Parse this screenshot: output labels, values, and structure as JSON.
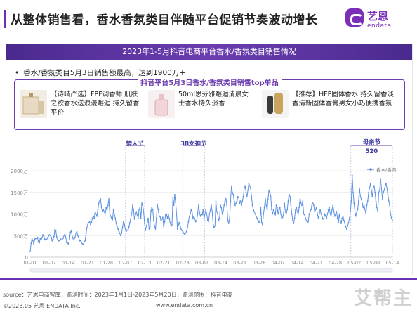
{
  "page": {
    "title": "从整体销售看，香水香氛类目伴随平台促销节奏波动增长",
    "logo_cn": "艺恩",
    "logo_en": "endata",
    "accent": "#6b2fb3"
  },
  "card": {
    "banner": "2023年1-5月抖音电商平台香水/香氛类目销售情况",
    "bullet": "香水/香氛类目5月3日销售额最高，达到1900万+",
    "products_title": "抖音平台5月3日香水/香氛类目销售top单品",
    "products": [
      {
        "text": "【诗晴严选】FPF调香师 肌肤之欲香水送浪漫邂逅 持久留香平价",
        "icon": "perfume-box-thumb"
      },
      {
        "text": "50ml思芬雅邂逅清晨女士香水持久淡香",
        "icon": "perfume-bottle-thumb"
      },
      {
        "text": "【推荐】HFP固体香水 持久留香淡香清新固体香膏男女小巧便携香氛",
        "icon": "solid-perfume-thumb"
      }
    ]
  },
  "chart_data": {
    "type": "line",
    "series": [
      {
        "name": "香水/香商",
        "color": "#5b8fe0"
      }
    ],
    "ylim": [
      0,
      2000
    ],
    "yticks": [
      "0",
      "500万",
      "1000万",
      "1500万",
      "2000万"
    ],
    "ytick_values": [
      0,
      500,
      1000,
      1500,
      2000
    ],
    "xticks": [
      "01-01",
      "01-07",
      "01-14",
      "01-21",
      "01-28",
      "02-07",
      "02-13",
      "02-21",
      "02-28",
      "03-07",
      "03-14",
      "03-21",
      "03-28",
      "04-07",
      "04-14",
      "04-21",
      "04-28",
      "05-02",
      "05-08",
      "05-14"
    ],
    "annotations": [
      {
        "label": "情人节",
        "from": "02-07",
        "to": "02-14"
      },
      {
        "label": "38女神节",
        "from": "02-28",
        "to": "03-08"
      },
      {
        "label": "母亲节",
        "sublabel": "520",
        "from": "05-01",
        "to": "05-20"
      }
    ],
    "values": [
      130,
      320,
      420,
      380,
      300,
      420,
      430,
      440,
      460,
      350,
      330,
      430,
      400,
      450,
      520,
      480,
      400,
      420,
      410,
      450,
      490,
      520,
      500,
      460,
      380,
      420,
      480,
      640,
      610,
      470,
      420,
      380,
      380,
      430,
      400,
      410,
      440,
      500,
      530,
      450,
      340,
      330,
      300,
      420,
      580,
      610,
      480,
      430,
      420,
      460,
      560,
      590,
      500,
      460,
      380,
      380,
      340,
      310,
      290,
      350,
      380,
      540,
      680,
      760,
      800,
      820,
      760,
      800,
      900,
      950,
      900,
      1050,
      1000,
      950,
      1100,
      1250,
      1300,
      1350,
      1150,
      1050,
      1100,
      1050,
      1000,
      1150,
      1100,
      1200,
      1350,
      1000,
      950,
      900,
      870,
      1100,
      1000,
      900,
      780,
      700,
      650,
      600,
      550,
      500,
      560,
      700,
      830,
      760,
      650,
      600,
      630,
      620,
      700,
      800,
      900,
      1000,
      1200,
      1100,
      880,
      980,
      1050,
      980,
      900,
      1100,
      1150,
      900,
      1250,
      1200,
      1050,
      780,
      620,
      720,
      800,
      900,
      650,
      700,
      1070,
      1150,
      1100,
      850,
      720,
      650,
      900,
      1230,
      1100,
      960,
      940,
      850,
      880,
      920,
      700,
      820,
      980,
      1000,
      900,
      1000,
      900,
      800,
      720,
      750,
      1380,
      1200,
      1450,
      1270,
      1000,
      650,
      750,
      800,
      720,
      650,
      620,
      580,
      550,
      520,
      560,
      600,
      680,
      820,
      950,
      1000,
      1100,
      1050,
      900,
      950,
      880,
      820,
      850,
      1000,
      1200,
      1050,
      950,
      1000,
      980,
      1100,
      900,
      1000,
      1100,
      1000,
      850,
      830,
      1000,
      1100,
      1200,
      1050,
      750,
      680,
      720,
      1300,
      1050,
      1000,
      850,
      900,
      1200,
      1150,
      1000,
      1050,
      1200,
      1300,
      1350,
      1200,
      850,
      780,
      900,
      1300,
      1650,
      1500,
      1450,
      1300,
      1200,
      1250,
      1300,
      1400,
      1380,
      1250,
      1300,
      1200,
      1300,
      1400,
      1600,
      1650,
      1500,
      1400,
      1550,
      1700,
      1650,
      1600,
      1400,
      1200,
      1100,
      1050,
      1000,
      950,
      900,
      850,
      800,
      820,
      1150,
      800,
      750,
      1000,
      1150,
      1350,
      1200,
      1100,
      1350,
      1550,
      1500,
      1400,
      1100,
      1000,
      1100,
      1050,
      980,
      1200,
      1150,
      1000,
      1100,
      1150,
      1000,
      900,
      920,
      1000,
      1250,
      1050,
      1000,
      1100,
      1300,
      1450,
      1400,
      1200,
      1000,
      850,
      780,
      900,
      1100,
      1150,
      1050,
      1000,
      1150,
      1350,
      1250,
      1200,
      1300,
      1000,
      980,
      900,
      850,
      800,
      820,
      1000,
      1050,
      1100,
      1200,
      1250,
      1200,
      1050,
      1100,
      1150,
      1000,
      900,
      1000,
      1100,
      1000,
      950,
      880,
      900,
      1000,
      950,
      900,
      1000,
      1100,
      1150,
      1000,
      950,
      1100,
      1200,
      1050,
      950,
      1000,
      1050,
      900,
      800,
      1000,
      850,
      780,
      900,
      950,
      850,
      780,
      700,
      650,
      720,
      800,
      900,
      1050,
      1300,
      1900,
      1500,
      1250,
      1050,
      950,
      1050,
      1100,
      1300,
      1600,
      1400,
      1350,
      1250,
      1150,
      1200,
      1100,
      1000,
      1200,
      1300,
      1500,
      1600,
      1700,
      1550,
      1400,
      1600,
      1650,
      1500,
      1300,
      1150,
      1050,
      1500,
      1550,
      1800,
      1600,
      1350,
      1500,
      1550,
      1650,
      1700,
      1600,
      1450,
      1300,
      1200,
      1000,
      900,
      850
    ]
  },
  "footer": {
    "source": "source：艺恩电商智库，监测时间：2023年1月1日-2023年5月20日，监测范围：抖音电商",
    "copyright": "©2023.05 艺恩 ENDATA Inc.",
    "url": "www.endata.com.cn",
    "watermark": "艾帮主"
  }
}
